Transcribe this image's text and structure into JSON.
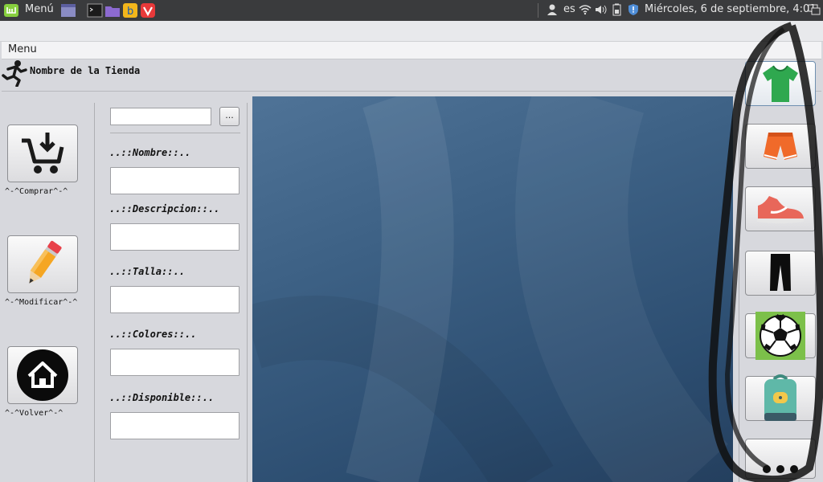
{
  "panel": {
    "menu_label": "Menú",
    "language": "es",
    "datetime": "Miércoles,  6 de septiembre,  4:01"
  },
  "window": {
    "menu_label": "Menu",
    "store_name": "Nombre de la Tienda"
  },
  "actions": [
    {
      "label": "^-^Comprar^-^",
      "icon": "cart-download-icon"
    },
    {
      "label": "^-^Modificar^-^",
      "icon": "pencil-icon"
    },
    {
      "label": "^-^Volver^-^",
      "icon": "home-icon"
    }
  ],
  "form": {
    "browse_label": "...",
    "fields": [
      {
        "label": "..::Nombre::..",
        "value": ""
      },
      {
        "label": "..::Descripcion::..",
        "value": ""
      },
      {
        "label": "..::Talla::..",
        "value": ""
      },
      {
        "label": "..::Colores::..",
        "value": ""
      },
      {
        "label": "..::Disponible::..",
        "value": ""
      }
    ]
  },
  "categories": [
    {
      "icon": "tshirt-icon",
      "selected": true
    },
    {
      "icon": "shorts-icon",
      "selected": false
    },
    {
      "icon": "sneaker-icon",
      "selected": false
    },
    {
      "icon": "pants-icon",
      "selected": false
    },
    {
      "icon": "soccer-ball-icon",
      "selected": false
    },
    {
      "icon": "backpack-icon",
      "selected": false
    },
    {
      "icon": "more-icon",
      "selected": false
    }
  ],
  "colors": {
    "panel_bg": "#3a3b3d",
    "preview_bg": "#3d6185",
    "tshirt": "#2fa84f",
    "shorts": "#f06a2a",
    "sneaker": "#e8675a",
    "ball_bg": "#7cc04a",
    "backpack": "#5fb8a8"
  }
}
